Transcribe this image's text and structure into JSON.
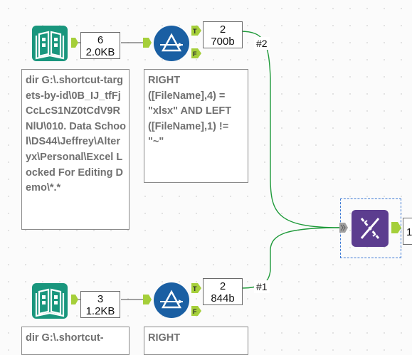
{
  "canvas": {
    "tools": [
      {
        "id": "dir-top",
        "type": "Directory",
        "icon": "directory-book-icon",
        "records": "6",
        "size": "2.0KB",
        "annotation": "dir G:\\.shortcut-targets-by-id\\0B_IJ_tfFjCcLcS1NZ0tCdV9RNlU\\010. Data School\\DS44\\Jeffrey\\Alteryx\\Personal\\Excel Locked For Editing Demo\\*.*"
      },
      {
        "id": "filter-top",
        "type": "Filter",
        "icon": "filter-triangle-icon",
        "true_records": "2",
        "true_size": "700b",
        "annotation": "RIGHT ([FileName],4) = \"xlsx\" AND LEFT ([FileName],1) != \"~\""
      },
      {
        "id": "dir-bottom",
        "type": "Directory",
        "icon": "directory-book-icon",
        "records": "3",
        "size": "1.2KB",
        "annotation": "dir G:\\.shortcut-"
      },
      {
        "id": "filter-bottom",
        "type": "Filter",
        "icon": "filter-triangle-icon",
        "true_records": "2",
        "true_size": "844b",
        "annotation": "RIGHT"
      },
      {
        "id": "make-group",
        "type": "Union",
        "icon": "dna-helix-icon",
        "output_partial": "1"
      }
    ],
    "connections": [
      {
        "from": "filter-top",
        "to": "make-group",
        "label": "#2"
      },
      {
        "from": "filter-bottom",
        "to": "make-group",
        "label": "#1"
      }
    ],
    "anchors": {
      "true_letter": "T",
      "false_letter": "F"
    },
    "colors": {
      "directory": "#19967d",
      "filter": "#1a5fa3",
      "union": "#5c3d8f",
      "anchor": "#a5cf3a",
      "wire": "#1f9a3a",
      "selection": "#3a78d4"
    }
  }
}
